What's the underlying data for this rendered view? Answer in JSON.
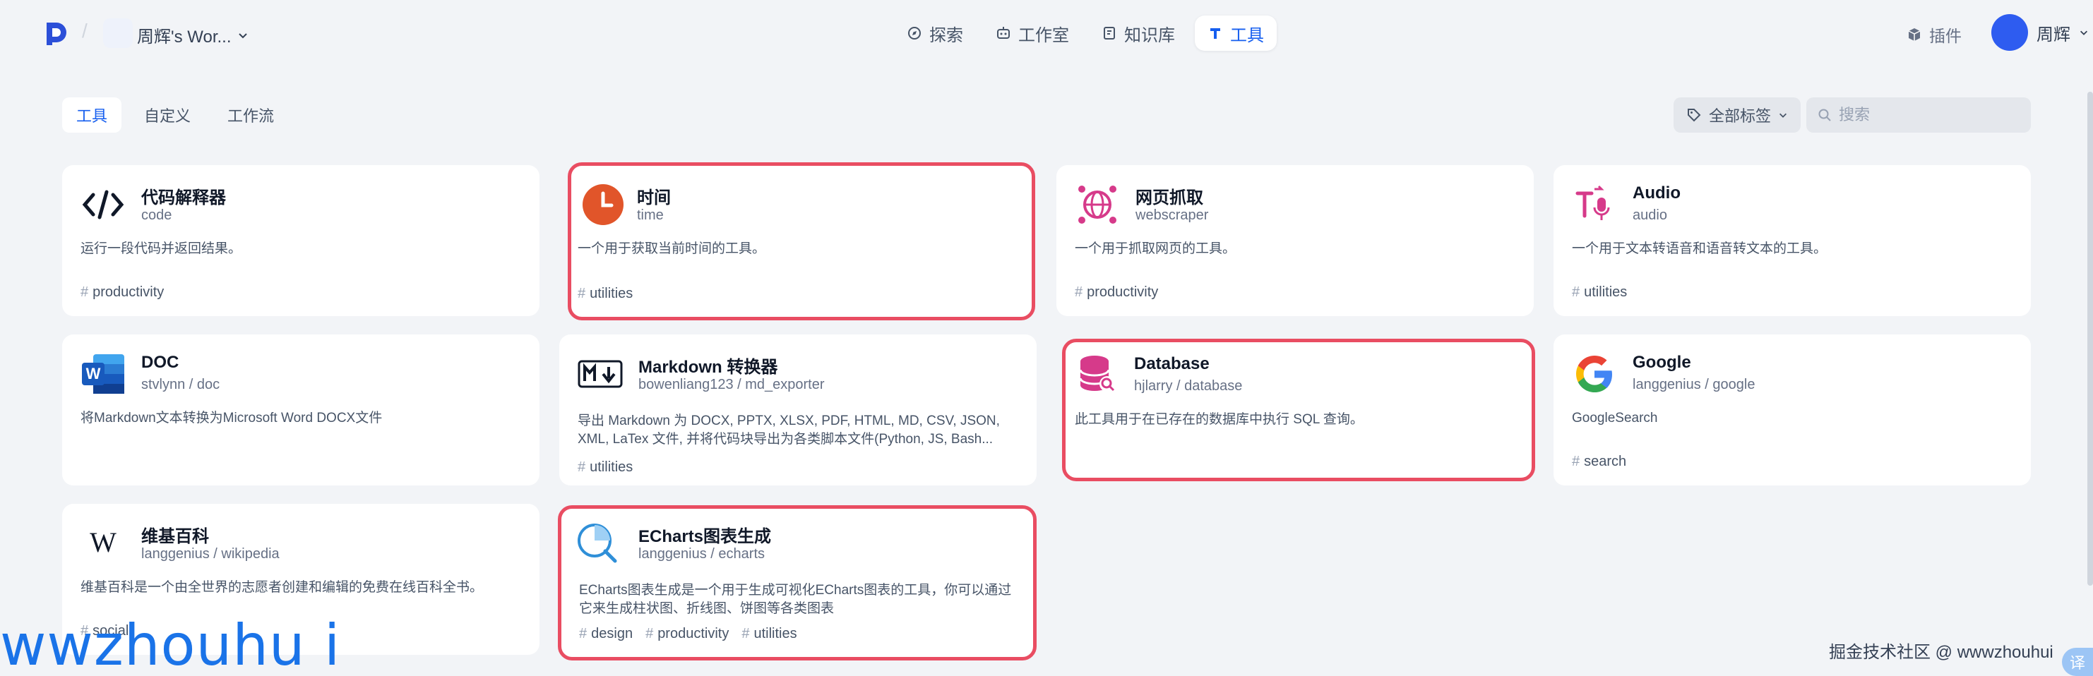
{
  "header": {
    "workspace_name": "周辉's Wor...",
    "nav": [
      {
        "label": "探索",
        "icon": "compass-icon"
      },
      {
        "label": "工作室",
        "icon": "robot-icon"
      },
      {
        "label": "知识库",
        "icon": "book-icon"
      },
      {
        "label": "工具",
        "icon": "tool-icon",
        "active": true
      }
    ],
    "plugin_label": "插件",
    "user_name": "周辉"
  },
  "filters": {
    "tabs": [
      "工具",
      "自定义",
      "工作流"
    ],
    "tag_filter_label": "全部标签",
    "search_placeholder": "搜索"
  },
  "cards": [
    {
      "title": "代码解释器",
      "sub": "code",
      "desc": "运行一段代码并返回结果。",
      "tags": [
        "productivity"
      ],
      "icon": "code-icon",
      "highlight": false
    },
    {
      "title": "时间",
      "sub": "time",
      "desc": "一个用于获取当前时间的工具。",
      "tags": [
        "utilities"
      ],
      "icon": "clock-icon",
      "highlight": true
    },
    {
      "title": "网页抓取",
      "sub": "webscraper",
      "desc": "一个用于抓取网页的工具。",
      "tags": [
        "productivity"
      ],
      "icon": "web-scraper-icon",
      "highlight": false
    },
    {
      "title": "Audio",
      "sub": "audio",
      "desc": "一个用于文本转语音和语音转文本的工具。",
      "tags": [
        "utilities"
      ],
      "icon": "audio-icon",
      "highlight": false
    },
    {
      "title": "DOC",
      "sub": "stvlynn / doc",
      "desc": "将Markdown文本转换为Microsoft Word DOCX文件",
      "tags": [],
      "icon": "word-icon",
      "highlight": false
    },
    {
      "title": "Markdown 转换器",
      "sub": "bowenliang123 / md_exporter",
      "desc": "导出 Markdown 为 DOCX, PPTX, XLSX, PDF, HTML, MD, CSV, JSON, XML, LaTex 文件, 并将代码块导出为各类脚本文件(Python, JS, Bash...",
      "tags": [
        "utilities"
      ],
      "icon": "markdown-icon",
      "highlight": false
    },
    {
      "title": "Database",
      "sub": "hjlarry / database",
      "desc": "此工具用于在已存在的数据库中执行 SQL 查询。",
      "tags": [],
      "icon": "database-icon",
      "highlight": true
    },
    {
      "title": "Google",
      "sub": "langgenius / google",
      "desc": "GoogleSearch",
      "tags": [
        "search"
      ],
      "icon": "google-icon",
      "highlight": false
    },
    {
      "title": "维基百科",
      "sub": "langgenius / wikipedia",
      "desc": "维基百科是一个由全世界的志愿者创建和编辑的免费在线百科全书。",
      "tags": [
        "social"
      ],
      "icon": "wikipedia-icon",
      "highlight": false
    },
    {
      "title": "ECharts图表生成",
      "sub": "langgenius / echarts",
      "desc": "ECharts图表生成是一个用于生成可视化ECharts图表的工具，你可以通过它来生成柱状图、折线图、饼图等各类图表",
      "tags": [
        "design",
        "productivity",
        "utilities"
      ],
      "icon": "echarts-icon",
      "highlight": true
    }
  ],
  "watermarks": {
    "left": "wwzhouhu i",
    "right": "掘金技术社区 @ wwwzhouhui",
    "corner": "译"
  }
}
